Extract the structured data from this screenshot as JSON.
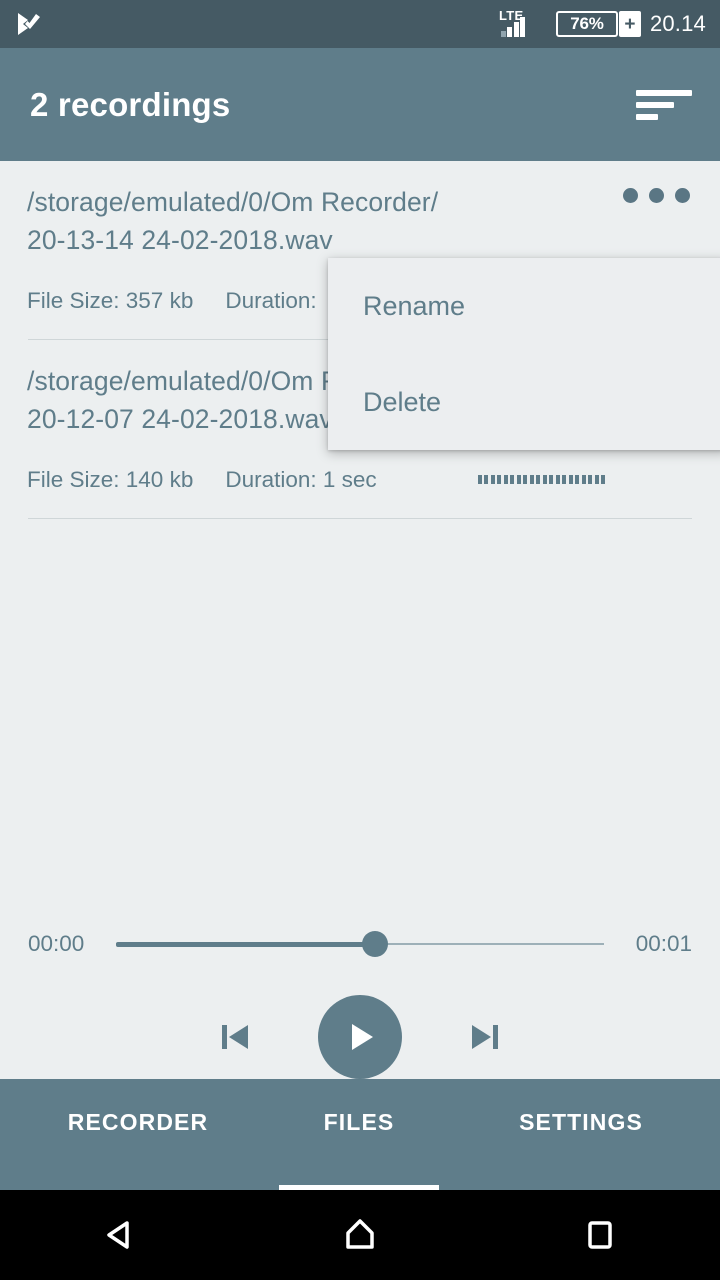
{
  "status_bar": {
    "app_icon": "play-check-icon",
    "network_type": "LTE",
    "signal_icon": "signal-bars-icon",
    "battery_percent": "76%",
    "battery_charging_icon": "battery-plus-icon",
    "clock": "20.14"
  },
  "app_bar": {
    "title": "2 recordings",
    "sort_icon": "sort-lines-icon"
  },
  "files": [
    {
      "path_line1": "/storage/emulated/0/Om Recorder/",
      "path_line2": "20-13-14 24-02-2018.wav",
      "file_size_label": "File Size: 357 kb",
      "duration_label": "Duration:",
      "overflow_icon": "more-horizontal-icon"
    },
    {
      "path_line1": "/storage/emulated/0/Om Recorder/",
      "path_line2": "20-12-07 24-02-2018.wav",
      "file_size_label": "File Size: 140 kb",
      "duration_label": "Duration: 1 sec",
      "waveform_icon": "mini-waveform-icon"
    }
  ],
  "popup_menu": {
    "items": [
      {
        "label": "Rename"
      },
      {
        "label": "Delete"
      }
    ]
  },
  "player": {
    "current_time": "00:00",
    "total_time": "00:01",
    "progress_percent": 53,
    "previous_icon": "skip-previous-icon",
    "play_icon": "play-icon",
    "next_icon": "skip-next-icon"
  },
  "tabs": [
    {
      "label": "RECORDER",
      "active": false
    },
    {
      "label": "FILES",
      "active": true
    },
    {
      "label": "SETTINGS",
      "active": false
    }
  ],
  "nav_bar": {
    "back_icon": "back-triangle-icon",
    "home_icon": "home-pentagon-icon",
    "recents_icon": "recents-square-icon"
  },
  "colors": {
    "status_bar": "#455a64",
    "app_bar": "#5f7d8a",
    "accent": "#5f7d8a",
    "page_background": "#eceff0",
    "nav_bar": "#000000"
  }
}
